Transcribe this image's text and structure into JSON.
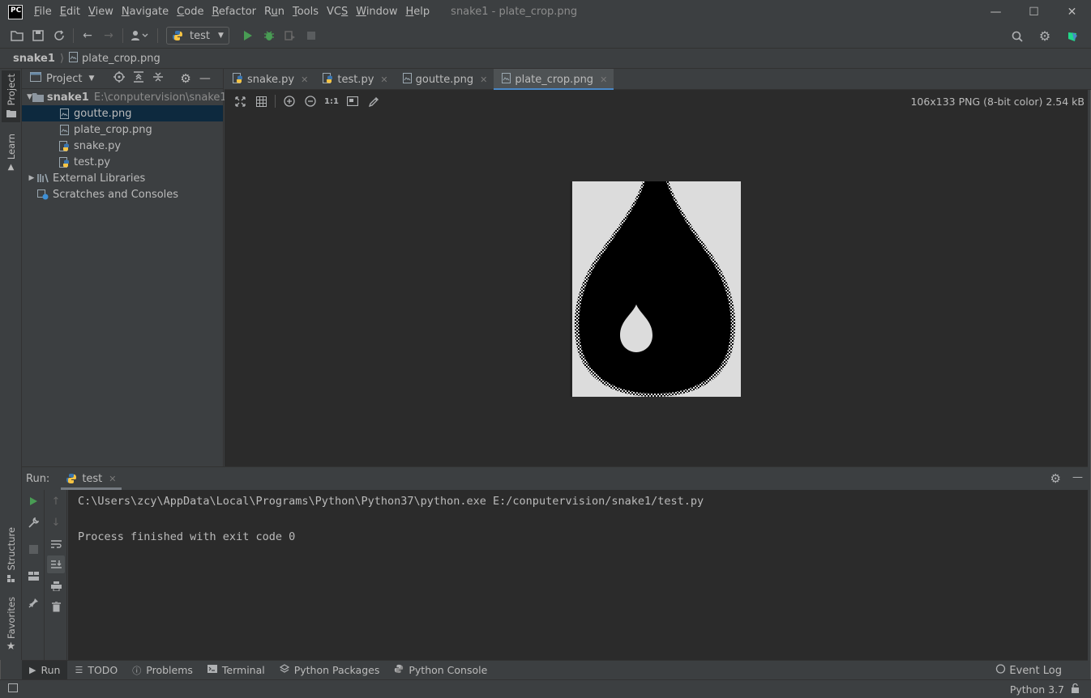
{
  "window": {
    "logo_text": "PC",
    "title": "snake1 - plate_crop.png",
    "menu": [
      "File",
      "Edit",
      "View",
      "Navigate",
      "Code",
      "Refactor",
      "Run",
      "Tools",
      "VCS",
      "Window",
      "Help"
    ],
    "menu_mnemonics": [
      "F",
      "E",
      "V",
      "N",
      "C",
      "R",
      "u",
      "T",
      "S",
      "W",
      "H"
    ]
  },
  "toolbar": {
    "run_config": "test"
  },
  "breadcrumb": {
    "root": "snake1",
    "file": "plate_crop.png"
  },
  "left_stripe": {
    "project": "Project",
    "learn": "Learn",
    "structure": "Structure",
    "favorites": "Favorites"
  },
  "project_panel": {
    "title": "Project",
    "root_name": "snake1",
    "root_path": "E:\\conputervision\\snake1",
    "files": [
      "goutte.png",
      "plate_crop.png",
      "snake.py",
      "test.py"
    ],
    "external_libraries": "External Libraries",
    "scratches": "Scratches and Consoles"
  },
  "editor_tabs": [
    {
      "label": "snake.py",
      "type": "py"
    },
    {
      "label": "test.py",
      "type": "py"
    },
    {
      "label": "goutte.png",
      "type": "img"
    },
    {
      "label": "plate_crop.png",
      "type": "img",
      "active": true
    }
  ],
  "image_viewer": {
    "zoom_actual": "1:1",
    "info": "106x133 PNG (8-bit color) 2.54 kB"
  },
  "run_panel": {
    "label": "Run:",
    "tab": "test",
    "console": [
      "C:\\Users\\zcy\\AppData\\Local\\Programs\\Python\\Python37\\python.exe E:/conputervision/snake1/test.py",
      "",
      "Process finished with exit code 0"
    ]
  },
  "bottom_tools": [
    "Run",
    "TODO",
    "Problems",
    "Terminal",
    "Python Packages",
    "Python Console"
  ],
  "event_log": "Event Log",
  "status": {
    "interpreter": "Python 3.7"
  },
  "colors": {
    "accent": "#4a88c7",
    "run_green": "#499c54",
    "selection": "#0d293e"
  }
}
